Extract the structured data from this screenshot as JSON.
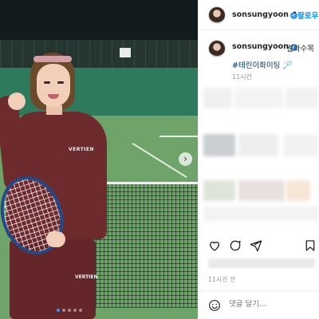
{
  "header": {
    "username": "sonsungyoon",
    "verified_badge": "✔",
    "separator": "•",
    "follow_label": "팔로우"
  },
  "caption": {
    "username": "sonsungyoon",
    "verified_badge": "✔",
    "text": "월화수목",
    "hashtag": "#테린이화이팅",
    "emoji": "🏸",
    "time": "11시간"
  },
  "actions": {
    "like_icon": "heart-icon",
    "comment_icon": "comment-icon",
    "share_icon": "send-icon",
    "save_icon": "bookmark-icon"
  },
  "post_time": "11시간 전",
  "comment_box": {
    "placeholder": "댓글 달기..."
  },
  "carousel": {
    "slide_count": 5,
    "active_index": 0,
    "next_icon": "chevron-right-icon",
    "next_glyph": "›"
  },
  "brand_text": {
    "top_logo": "VERTIEN",
    "pants_logo": "VERTIEN"
  },
  "colors": {
    "link": "#00376b",
    "follow": "#0095f6",
    "verified": "#3897f0",
    "active_dot": "#2f90ff"
  }
}
